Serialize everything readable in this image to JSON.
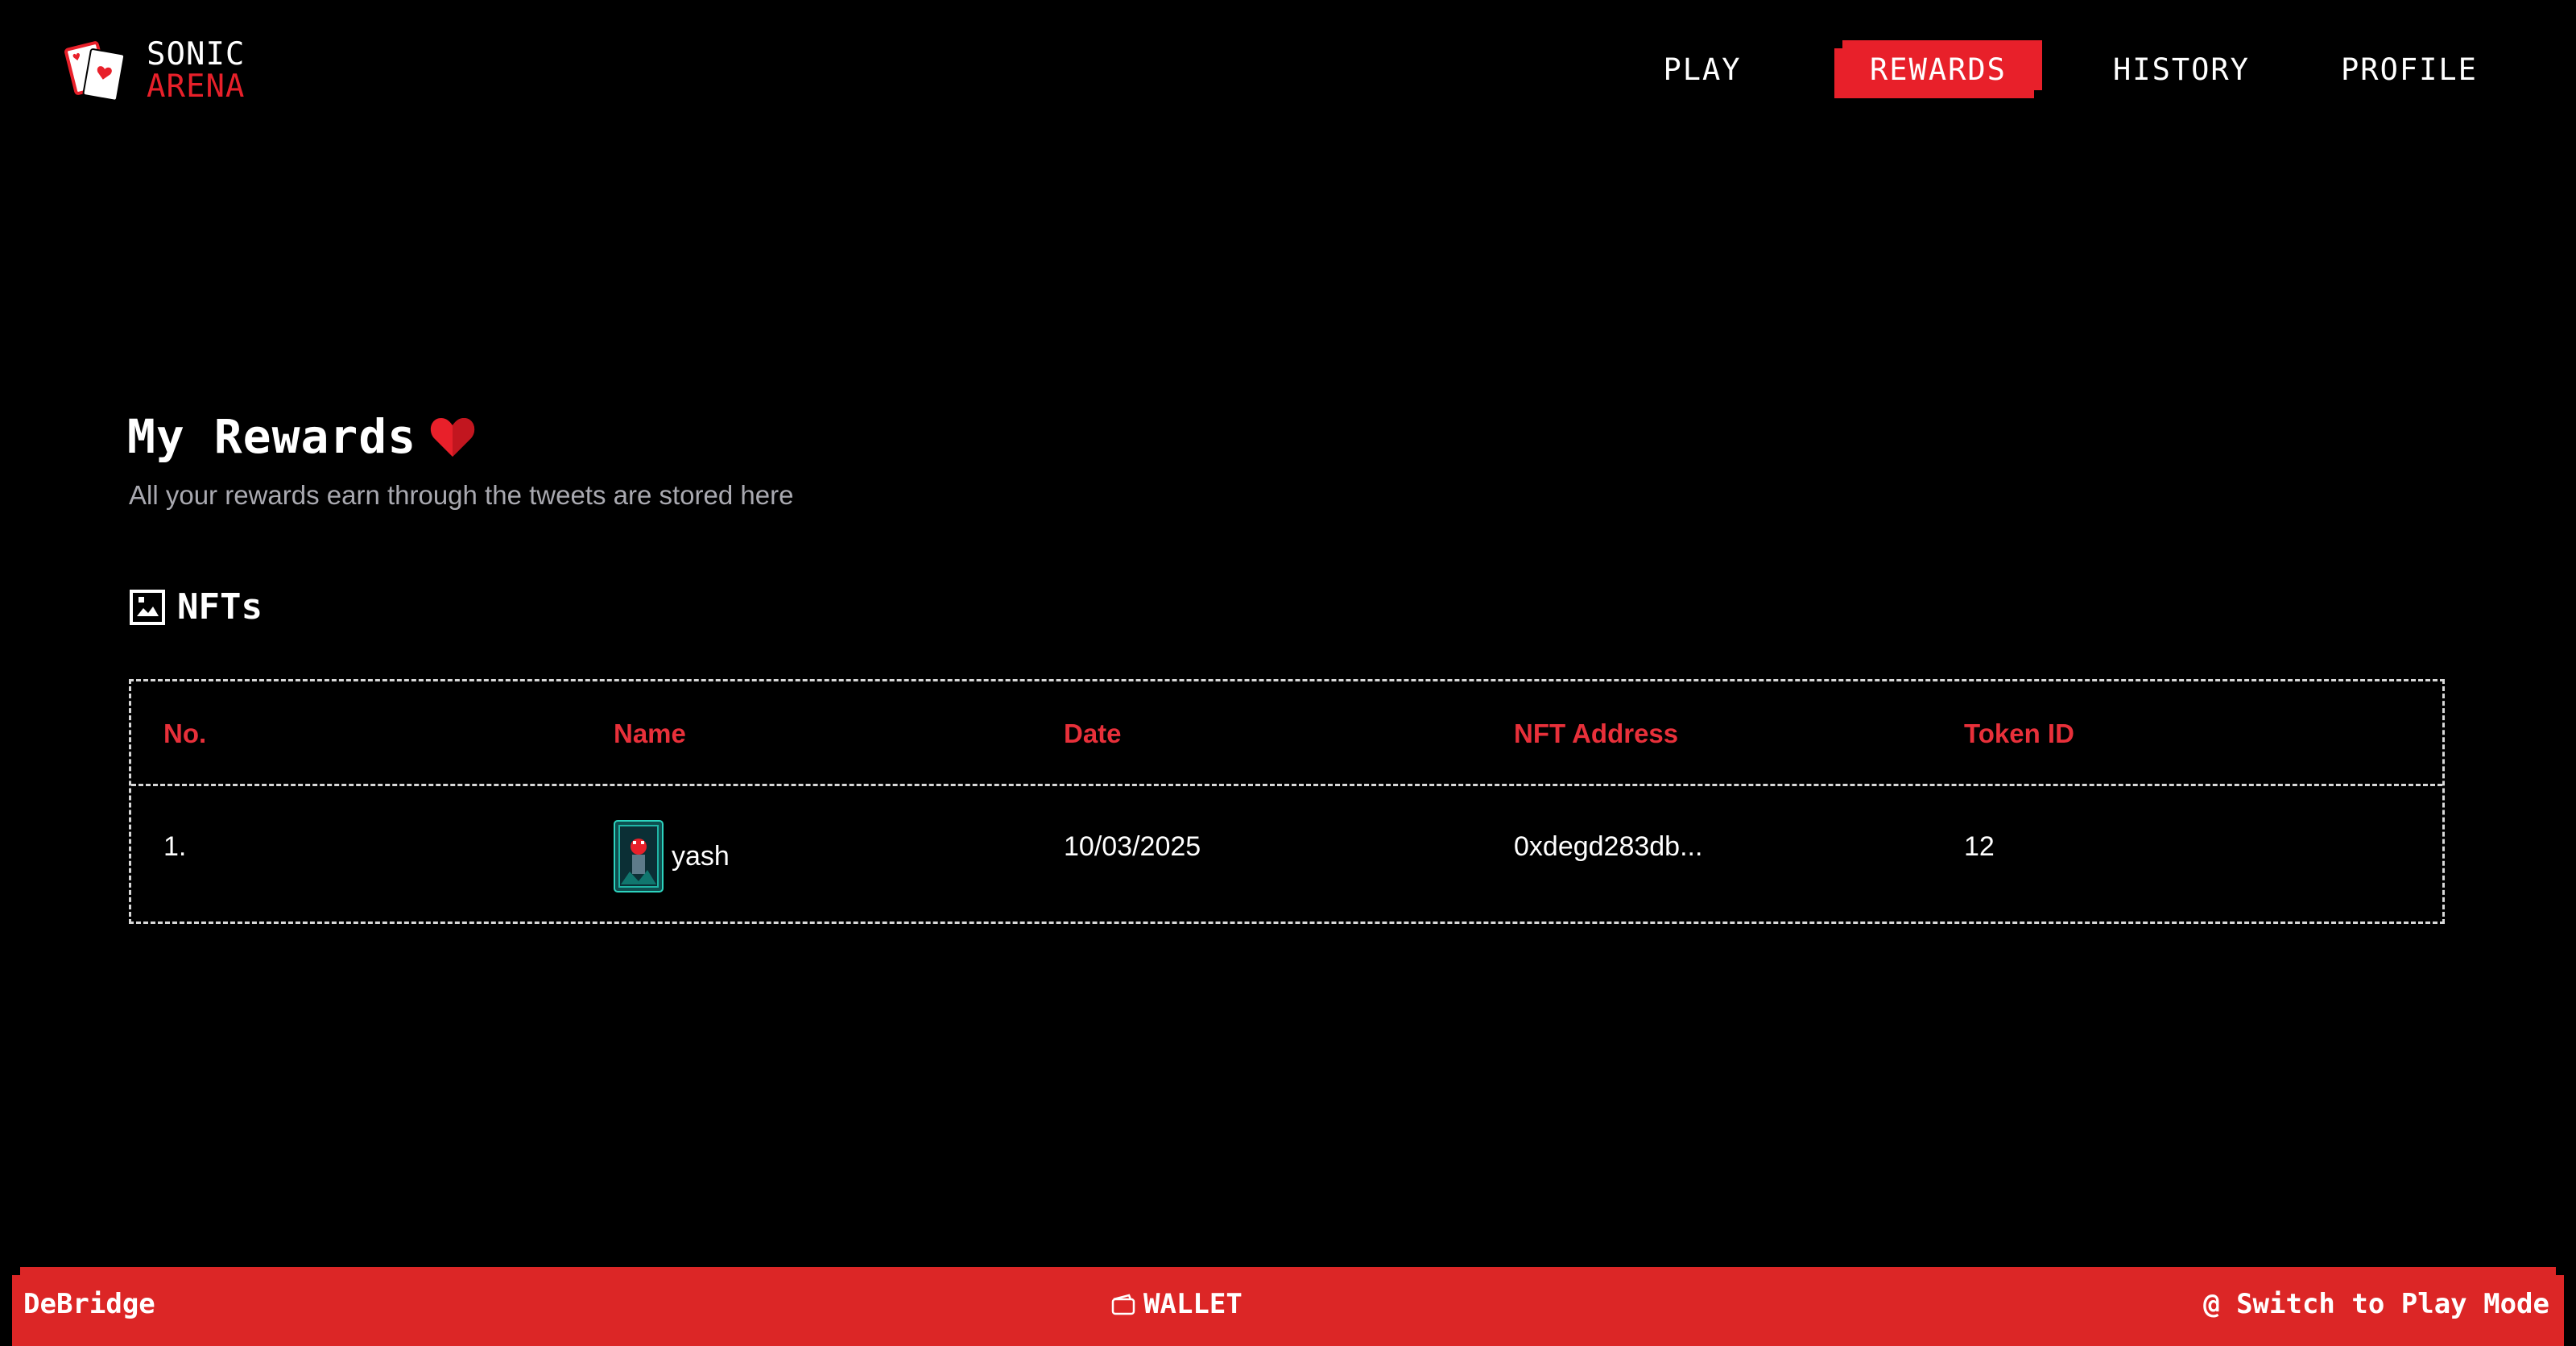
{
  "brand": {
    "line1": "SONIC",
    "line2": "ARENA",
    "accent_color": "#e8202a"
  },
  "nav": {
    "play": "PLAY",
    "rewards": "REWARDS",
    "history": "HISTORY",
    "profile": "PROFILE",
    "active": "REWARDS"
  },
  "main": {
    "title": "My Rewards",
    "subtitle": "All your rewards earn through the tweets are stored here",
    "section_title": "NFTs"
  },
  "table": {
    "headers": [
      "No.",
      "Name",
      "Date",
      "NFT Address",
      "Token ID"
    ],
    "rows": [
      {
        "no": "1.",
        "name": "yash",
        "date": "10/03/2025",
        "address": "0xdegd283db...",
        "token_id": "12"
      }
    ]
  },
  "footer": {
    "left": "DeBridge",
    "center": "WALLET",
    "right": "@ Switch to Play Mode"
  },
  "icons": {
    "logo": "playing-cards-icon",
    "title": "heart-icon",
    "section": "nft-image-icon",
    "wallet": "wallet-icon"
  }
}
